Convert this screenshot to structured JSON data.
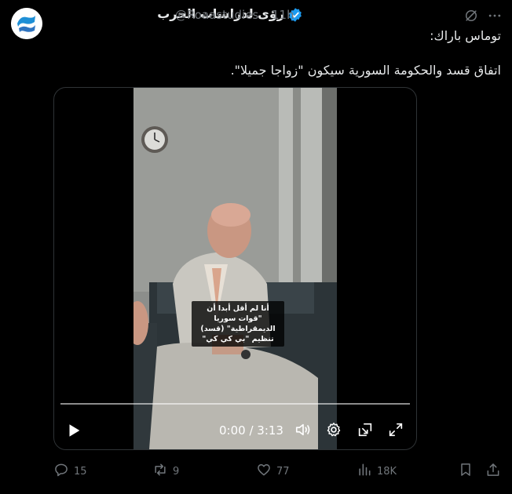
{
  "author": {
    "name": "رؤى لدراسات الحرب",
    "handle": "@Roaastudies",
    "separator": "·",
    "time": "11h"
  },
  "tweet": {
    "line1": "توماس باراك:",
    "line2": "اتفاق قسد والحكومة السورية سيكون \"زواجا جميلا\"."
  },
  "video": {
    "caption": "أنا لم أقل أبدا أن \"قوات سوريا الديمقراطية\" (قسد) تنظيم \"بي كي كي\"",
    "time_display": "0:00 / 3:13",
    "progress": 0
  },
  "actions": {
    "replies": "15",
    "reposts": "9",
    "likes": "77",
    "views": "18K"
  },
  "colors": {
    "accent": "#1d9bf0",
    "muted": "#71767b",
    "text": "#e7e9ea"
  }
}
